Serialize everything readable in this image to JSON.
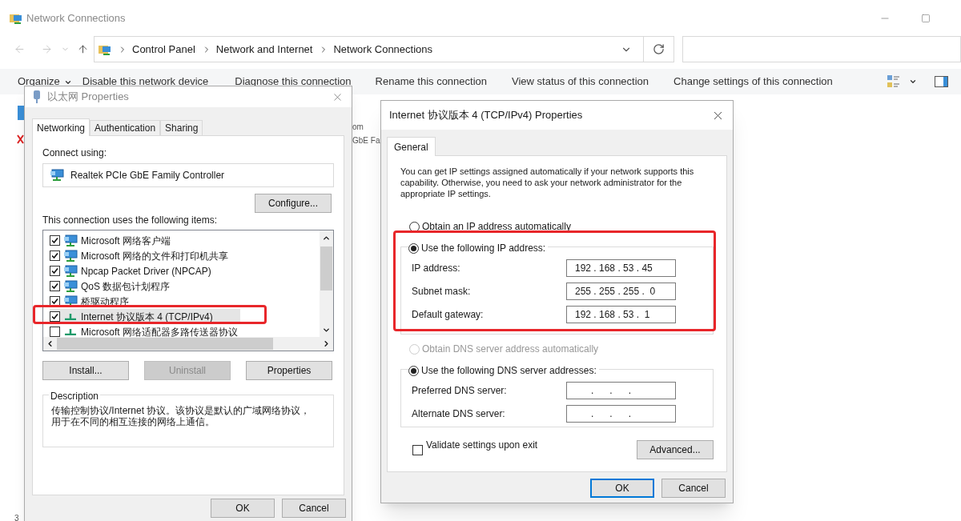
{
  "window": {
    "title": "Network Connections"
  },
  "address_bar": {
    "path": [
      "Control Panel",
      "Network and Internet",
      "Network Connections"
    ]
  },
  "toolbar": {
    "items": [
      "Organize",
      "Disable this network device",
      "Diagnose this connection",
      "Rename this connection",
      "View status of this connection",
      "Change settings of this connection"
    ]
  },
  "background_texts": [
    "om",
    "GbE Fa"
  ],
  "status_bar": "3",
  "ethernet_dialog": {
    "title": "以太网 Properties",
    "tabs": [
      {
        "label": "Networking",
        "selected": true
      },
      {
        "label": "Authentication",
        "selected": false
      },
      {
        "label": "Sharing",
        "selected": false
      }
    ],
    "connect_using_label": "Connect using:",
    "adapter": "Realtek PCIe GbE Family Controller",
    "configure_button": "Configure...",
    "items_label": "This connection uses the following items:",
    "items": [
      {
        "label": "Microsoft 网络客户端",
        "checked": true,
        "selected": false,
        "kind": "client"
      },
      {
        "label": "Microsoft 网络的文件和打印机共享",
        "checked": true,
        "selected": false,
        "kind": "client"
      },
      {
        "label": "Npcap Packet Driver (NPCAP)",
        "checked": true,
        "selected": false,
        "kind": "client"
      },
      {
        "label": "QoS 数据包计划程序",
        "checked": true,
        "selected": false,
        "kind": "client"
      },
      {
        "label": "桥驱动程序",
        "checked": true,
        "selected": false,
        "kind": "client"
      },
      {
        "label": "Internet 协议版本 4 (TCP/IPv4)",
        "checked": true,
        "selected": true,
        "kind": "protocol"
      },
      {
        "label": "Microsoft 网络适配器多路传送器协议",
        "checked": false,
        "selected": false,
        "kind": "protocol"
      }
    ],
    "buttons": [
      {
        "label": "Install...",
        "disabled": false
      },
      {
        "label": "Uninstall",
        "disabled": true
      },
      {
        "label": "Properties",
        "disabled": false
      }
    ],
    "description": {
      "legend": "Description",
      "text": "传输控制协议/Internet 协议。该协议是默认的广域网络协议，用于在不同的相互连接的网络上通信。"
    },
    "footer_buttons": [
      {
        "label": "OK",
        "default": false
      },
      {
        "label": "Cancel",
        "default": false
      }
    ]
  },
  "ipv4_dialog": {
    "title": "Internet 协议版本 4 (TCP/IPv4) Properties",
    "tabs": [
      {
        "label": "General",
        "selected": true
      }
    ],
    "intro": "You can get IP settings assigned automatically if your network supports this capability. Otherwise, you need to ask your network administrator for the appropriate IP settings.",
    "ip_mode": [
      {
        "label": "Obtain an IP address automatically",
        "selected": false,
        "disabled": false
      },
      {
        "label": "Use the following IP address:",
        "selected": true,
        "disabled": false
      }
    ],
    "ip_fields": [
      {
        "label": "IP address:",
        "value": "192 . 168 . 53 . 45"
      },
      {
        "label": "Subnet mask:",
        "value": "255 . 255 . 255 .  0"
      },
      {
        "label": "Default gateway:",
        "value": "192 . 168 . 53 .  1"
      }
    ],
    "dns_mode": [
      {
        "label": "Obtain DNS server address automatically",
        "selected": false,
        "disabled": true
      },
      {
        "label": "Use the following DNS server addresses:",
        "selected": true,
        "disabled": false
      }
    ],
    "dns_fields": [
      {
        "label": "Preferred DNS server:",
        "value": "      .      .      ."
      },
      {
        "label": "Alternate DNS server:",
        "value": "      .      .      ."
      }
    ],
    "validate": {
      "label": "Validate settings upon exit",
      "checked": false
    },
    "advanced_button": "Advanced...",
    "footer_buttons": [
      {
        "label": "OK",
        "default": true
      },
      {
        "label": "Cancel",
        "default": false
      }
    ]
  }
}
